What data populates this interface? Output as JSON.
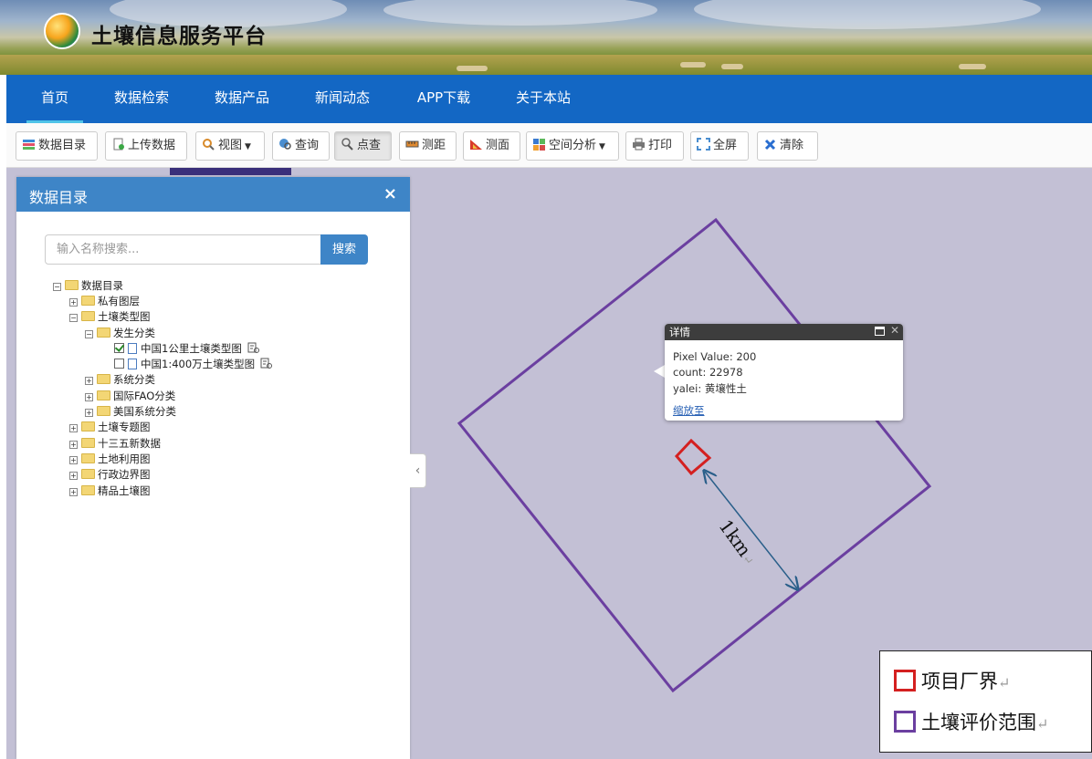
{
  "site": {
    "title": "土壤信息服务平台"
  },
  "nav": {
    "items": [
      {
        "label": "首页"
      },
      {
        "label": "数据检索"
      },
      {
        "label": "数据产品"
      },
      {
        "label": "新闻动态"
      },
      {
        "label": "APP下载"
      },
      {
        "label": "关于本站"
      }
    ],
    "active": "首页"
  },
  "toolbar": {
    "buttons": [
      {
        "label": "数据目录",
        "icon": "layers-icon"
      },
      {
        "label": "上传数据",
        "icon": "upload-file-icon"
      },
      {
        "label": "视图",
        "icon": "magnifier-icon"
      },
      {
        "label": "查询",
        "icon": "globe-search-icon"
      },
      {
        "label": "点查",
        "icon": "point-query-icon"
      },
      {
        "label": "测距",
        "icon": "ruler-icon"
      },
      {
        "label": "测面",
        "icon": "area-measure-icon"
      },
      {
        "label": "空间分析",
        "icon": "spatial-analysis-icon"
      },
      {
        "label": "打印",
        "icon": "printer-icon"
      },
      {
        "label": "全屏",
        "icon": "fullscreen-icon"
      },
      {
        "label": "清除",
        "icon": "clear-x-icon"
      }
    ],
    "pressed": "点查"
  },
  "panel": {
    "title": "数据目录",
    "close": "×",
    "search_placeholder": "输入名称搜索...",
    "search_button": "搜索",
    "tree": [
      {
        "label": "数据目录",
        "toggle": "⊟"
      },
      {
        "label": "私有图层",
        "toggle": "⊞"
      },
      {
        "label": "土壤类型图",
        "toggle": "⊟"
      },
      {
        "label": "发生分类",
        "toggle": "⊟"
      },
      {
        "label": "中国1公里土壤类型图",
        "checked": true
      },
      {
        "label": "中国1:400万土壤类型图",
        "checked": false
      },
      {
        "label": "系统分类",
        "toggle": "⊞"
      },
      {
        "label": "国际FAO分类",
        "toggle": "⊞"
      },
      {
        "label": "美国系统分类",
        "toggle": "⊞"
      },
      {
        "label": "土壤专题图",
        "toggle": "⊞"
      },
      {
        "label": "十三五新数据",
        "toggle": "⊞"
      },
      {
        "label": "土地利用图",
        "toggle": "⊞"
      },
      {
        "label": "行政边界图",
        "toggle": "⊞"
      },
      {
        "label": "精品土壤图",
        "toggle": "⊞"
      }
    ]
  },
  "popup": {
    "title": "详情",
    "lines": [
      "Pixel Value: 200",
      "count: 22978",
      "yalei: 黄壤性土"
    ],
    "link": "缩放至",
    "close": "✕"
  },
  "map": {
    "distance_label": "1km",
    "return_mark": "↵",
    "collapse": "‹"
  },
  "legend": {
    "items": [
      {
        "label": "项目厂界",
        "color": "#d42020"
      },
      {
        "label": "土壤评价范围",
        "color": "#6b3fa0"
      }
    ],
    "return_mark": "↵"
  },
  "colors": {
    "nav_bg": "#1367c4",
    "panel_header": "#3e85c7",
    "map_bg": "#c3c0d5",
    "boundary_purple": "#6b3fa0",
    "boundary_red": "#d42020",
    "arrow_blue": "#2a5f8a"
  }
}
